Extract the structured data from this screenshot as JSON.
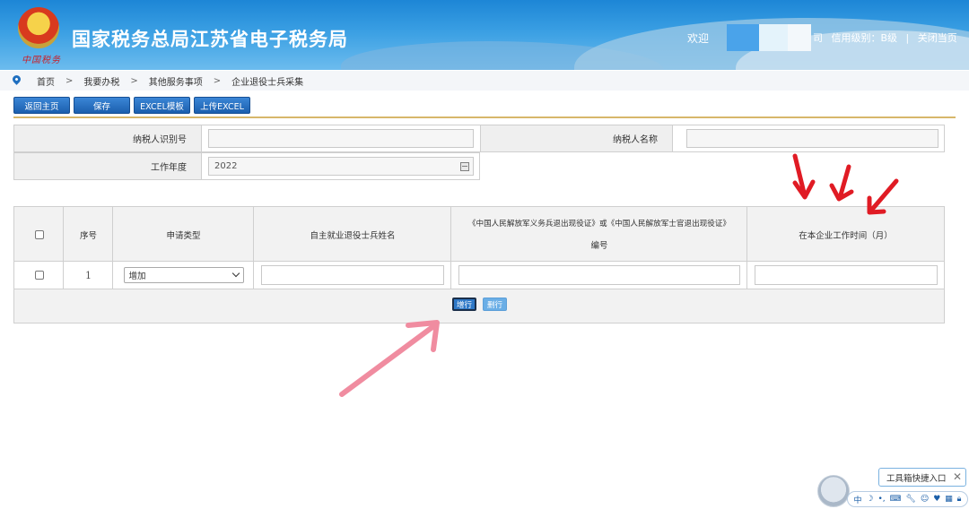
{
  "header": {
    "site_title": "国家税务总局江苏省电子税务局",
    "emblem_signature": "中国税务",
    "welcome": "欢迎",
    "name_suffix": "司",
    "credit_level": "信用级别：B级",
    "separator": "|",
    "close_page": "关闭当页",
    "colors": {
      "primary": "#1d86d6",
      "accent": "#3a9fe3"
    }
  },
  "breadcrumb": {
    "icon": "location-pin-icon",
    "items": [
      "首页",
      "我要办税",
      "其他服务事项",
      "企业退役士兵采集"
    ],
    "separator": ">"
  },
  "toolbar": {
    "back_label": "返回主页",
    "save_label": "保存",
    "excel_template_label": "EXCEL模板",
    "upload_excel_label": "上传EXCEL"
  },
  "info": {
    "taxpayer_id_label": "纳税人识别号",
    "taxpayer_id_value": "",
    "taxpayer_name_label": "纳税人名称",
    "taxpayer_name_value": "",
    "work_year_label": "工作年度",
    "work_year_value": "2022"
  },
  "table": {
    "headers": {
      "select": "",
      "index": "序号",
      "apply_type": "申请类型",
      "name": "自主就业退役士兵姓名",
      "cert_line1": "《中国人民解放军义务兵退出现役证》或《中国人民解放军士官退出现役证》",
      "cert_line2": "编号",
      "months": "在本企业工作时间（月）"
    },
    "rows": [
      {
        "index": "1",
        "apply_type": "增加",
        "name": "",
        "cert_no": "",
        "months": ""
      }
    ],
    "add_row_label": "增行",
    "delete_row_label": "删行"
  },
  "widget": {
    "quick_entry_label": "工具箱快捷入口",
    "close_symbol": "✕",
    "bar_icons": [
      "中",
      "moon-icon",
      "punctuation-icon",
      "keyboard-icon",
      "wrench-icon",
      "smile-icon",
      "shirt-icon",
      "grid-icon",
      "lock-icon"
    ]
  },
  "annotations": {
    "arrow_color": "#e01b24",
    "pink_arrow_color": "#f08ca0"
  }
}
